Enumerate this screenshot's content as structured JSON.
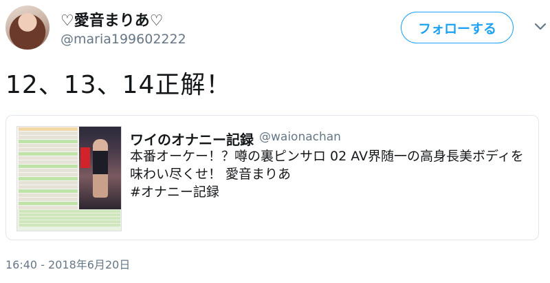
{
  "tweet": {
    "display_name": "♡愛音まりあ♡",
    "screen_name": "@maria199602222",
    "follow_label": "フォローする",
    "text": "12、13、14正解！",
    "timestamp": "16:40 - 2018年6月20日"
  },
  "quote": {
    "name": "ワイのオナニー記録",
    "handle": "@waionachan",
    "lines": [
      "本番オーケー！？噂の裏ピンサロ 02 AV界随一の高身長美ボディを",
      "味わい尽くせ！ 愛音まりあ",
      "#オナニー記録"
    ]
  },
  "icons": {
    "more": "chevron-down-icon",
    "avatar": "profile-photo"
  },
  "colors": {
    "accent": "#1da1f2",
    "secondary_text": "#657786",
    "border": "#e1e8ed"
  }
}
